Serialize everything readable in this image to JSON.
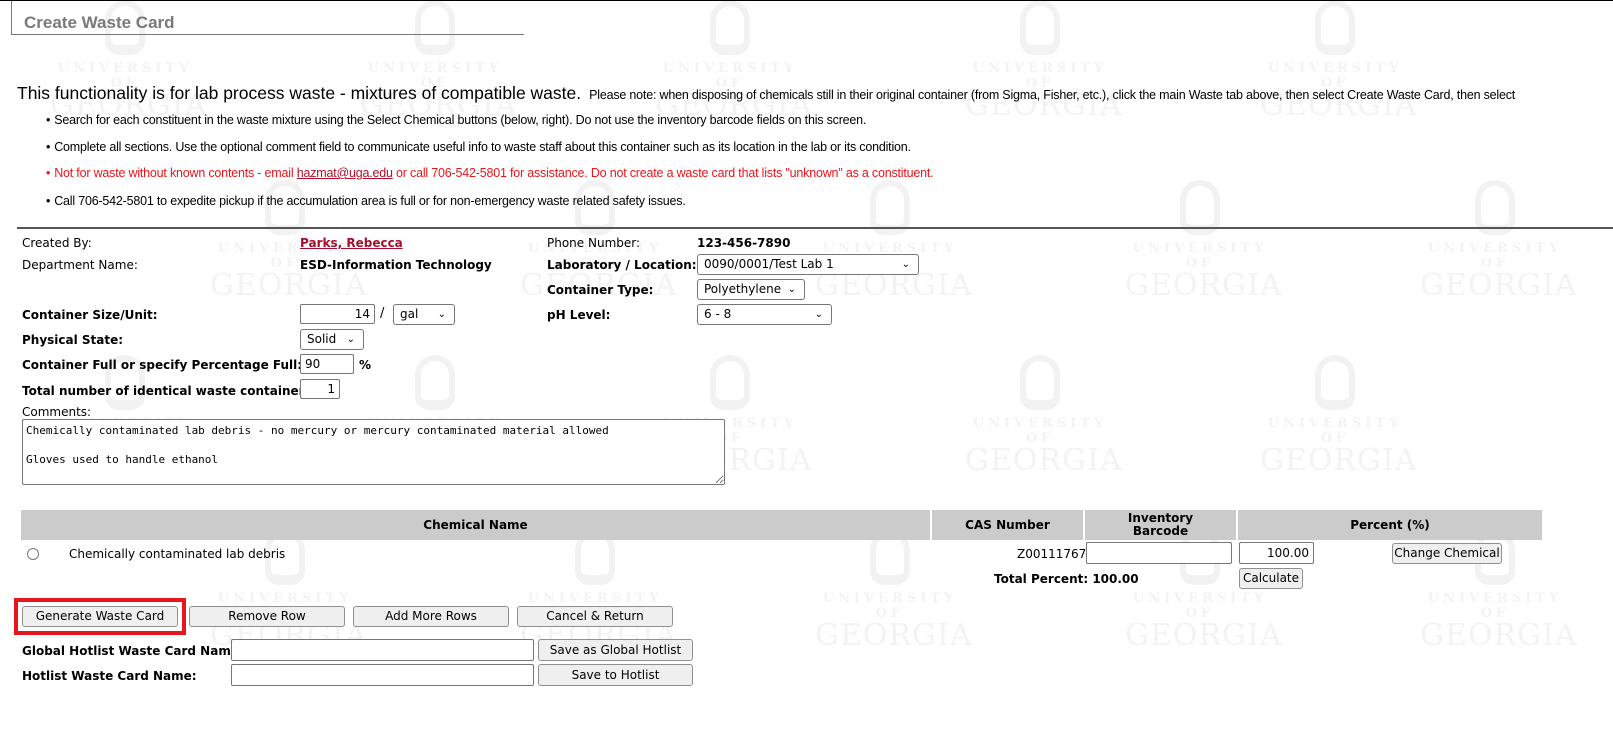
{
  "watermark": {
    "line1": "UNIVERSITY OF",
    "line2": "GEORGIA"
  },
  "page": {
    "title": "Create Waste Card"
  },
  "intro": {
    "headline": "This functionality is for lab process waste - mixtures of compatible waste.",
    "note": "Please note: when disposing of chemicals still in their original container (from Sigma, Fisher, etc.), click the main Waste tab above, then select Create Waste Card, then select"
  },
  "bullets": [
    {
      "text": "Search for each constituent in the waste mixture using the Select Chemical buttons (below, right).  Do not use the inventory barcode fields on this screen."
    },
    {
      "text": "Complete all sections.  Use the optional comment field to communicate useful info to waste staff about this container such as its location in the lab or its condition."
    },
    {
      "pre": "Not for waste without known contents - email ",
      "link": "hazmat@uga.edu",
      "post": " or call 706-542-5801 for assistance.  Do not create a waste card that lists \"unknown\" as a constituent."
    },
    {
      "text": "Call 706-542-5801 to expedite pickup if the accumulation area is full or for non-emergency waste related safety issues."
    }
  ],
  "form": {
    "created_by_label": "Created By:",
    "created_by_value": "Parks, Rebecca",
    "department_label": "Department Name:",
    "department_value": "ESD-Information Technology",
    "phone_label": "Phone Number:",
    "phone_value": "123-456-7890",
    "lab_label": "Laboratory / Location:",
    "lab_value": "0090/0001/Test Lab 1",
    "container_type_label": "Container Type:",
    "container_type_value": "Polyethylene",
    "size_label": "Container Size/Unit:",
    "size_value": "14",
    "size_sep": "/",
    "unit_value": "gal",
    "ph_label": "pH Level:",
    "ph_value": "6 - 8",
    "state_label": "Physical State:",
    "state_value": "Solid",
    "full_label": "Container Full or specify Percentage Full:",
    "full_value": "90",
    "full_unit": "%",
    "count_label": "Total number of identical waste containers:",
    "count_value": "1",
    "comments_label": "Comments:",
    "comments_value": "Chemically contaminated lab debris - no mercury or mercury contaminated material allowed\n\nGloves used to handle ethanol"
  },
  "table": {
    "headers": [
      "Chemical Name",
      "CAS Number",
      "Inventory Barcode",
      "Percent (%)"
    ],
    "rows": [
      {
        "name": "Chemically contaminated lab debris",
        "cas": "Z00111767",
        "barcode": "",
        "percent": "100.00",
        "action": "Change Chemical"
      }
    ],
    "total_label": "Total Percent: 100.00",
    "calculate_label": "Calculate"
  },
  "actions": {
    "generate": "Generate Waste Card",
    "remove_row": "Remove Row",
    "add_rows": "Add More Rows",
    "cancel": "Cancel & Return",
    "highlight_color": "#e8161c"
  },
  "hotlist": {
    "global_label": "Global Hotlist Waste Card Name:",
    "global_value": "",
    "global_button": "Save as Global Hotlist",
    "local_label": "Hotlist Waste Card Name:",
    "local_value": "",
    "local_button": "Save to Hotlist"
  }
}
